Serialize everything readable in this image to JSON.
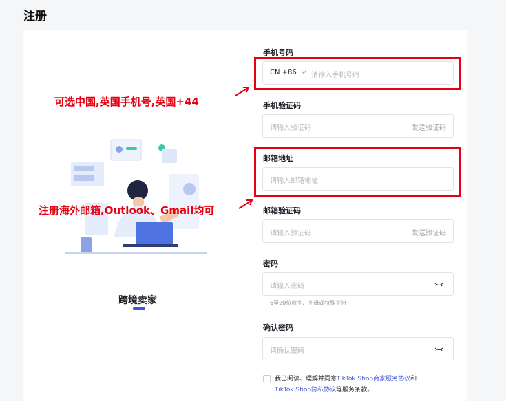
{
  "page": {
    "title": "注册"
  },
  "seller": {
    "label": "跨境卖家"
  },
  "form": {
    "phone": {
      "label": "手机号码",
      "country_code": "CN +86",
      "placeholder": "请输入手机号码"
    },
    "phone_code": {
      "label": "手机验证码",
      "placeholder": "请输入验证码",
      "send_label": "发送验证码"
    },
    "email": {
      "label": "邮箱地址",
      "placeholder": "请输入邮箱地址"
    },
    "email_code": {
      "label": "邮箱验证码",
      "placeholder": "请输入验证码",
      "send_label": "发送验证码"
    },
    "password": {
      "label": "密码",
      "placeholder": "请输入密码",
      "hint": "6至20位数字、字母或特殊字符"
    },
    "confirm_password": {
      "label": "确认密码",
      "placeholder": "请确认密码"
    },
    "agreement": {
      "prefix": "我已阅读、理解并同意",
      "link1": "TikTok Shop商家服务协议",
      "conj": "和",
      "link2": "TikTok Shop隐私协议",
      "suffix": "等服务条款。"
    }
  },
  "annotations": {
    "phone_note": "可选中国,英国手机号,英国+44",
    "email_note": "注册海外邮箱,Outlook、Gmail均可"
  },
  "colors": {
    "accent": "#4352d8",
    "annotation_red": "#e60012"
  }
}
